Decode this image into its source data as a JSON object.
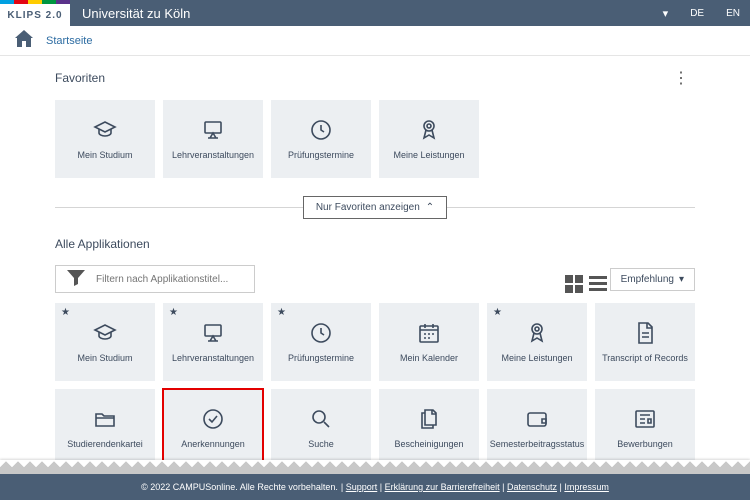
{
  "header": {
    "logo": "KLIPS 2.0",
    "university": "Universität zu Köln",
    "lang_de": "DE",
    "lang_en": "EN"
  },
  "breadcrumb": {
    "home": "Startseite"
  },
  "favorites": {
    "title": "Favoriten",
    "items": [
      {
        "label": "Mein Studium",
        "icon": "graduation"
      },
      {
        "label": "Lehrveranstaltungen",
        "icon": "board"
      },
      {
        "label": "Prüfungstermine",
        "icon": "clock"
      },
      {
        "label": "Meine Leistungen",
        "icon": "medal"
      }
    ]
  },
  "toggle_label": "Nur Favoriten anzeigen",
  "all_apps": {
    "title": "Alle Applikationen",
    "filter_placeholder": "Filtern nach Applikationstitel...",
    "sort_label": "Empfehlung",
    "items": [
      {
        "label": "Mein Studium",
        "icon": "graduation",
        "fav": true
      },
      {
        "label": "Lehrveranstaltungen",
        "icon": "board",
        "fav": true
      },
      {
        "label": "Prüfungstermine",
        "icon": "clock",
        "fav": true
      },
      {
        "label": "Mein Kalender",
        "icon": "calendar",
        "fav": false
      },
      {
        "label": "Meine Leistungen",
        "icon": "medal",
        "fav": true
      },
      {
        "label": "Transcript of Records",
        "icon": "document",
        "fav": false
      },
      {
        "label": "Studierendenkartei",
        "icon": "folder",
        "fav": false
      },
      {
        "label": "Anerkennungen",
        "icon": "check",
        "fav": false,
        "highlighted": true
      },
      {
        "label": "Suche",
        "icon": "search",
        "fav": false
      },
      {
        "label": "Bescheinigungen",
        "icon": "copies",
        "fav": false
      },
      {
        "label": "Semesterbeitragsstatus",
        "icon": "wallet",
        "fav": false
      },
      {
        "label": "Bewerbungen",
        "icon": "news",
        "fav": false
      }
    ]
  },
  "footer": {
    "copyright": "© 2022 CAMPUSonline. Alle Rechte vorbehalten.",
    "links": [
      "Support",
      "Erklärung zur Barrierefreiheit",
      "Datenschutz",
      "Impressum"
    ]
  },
  "colors": {
    "stripes": [
      "#00a0e1",
      "#e30613",
      "#ffcc00",
      "#009640",
      "#5a328a"
    ]
  }
}
